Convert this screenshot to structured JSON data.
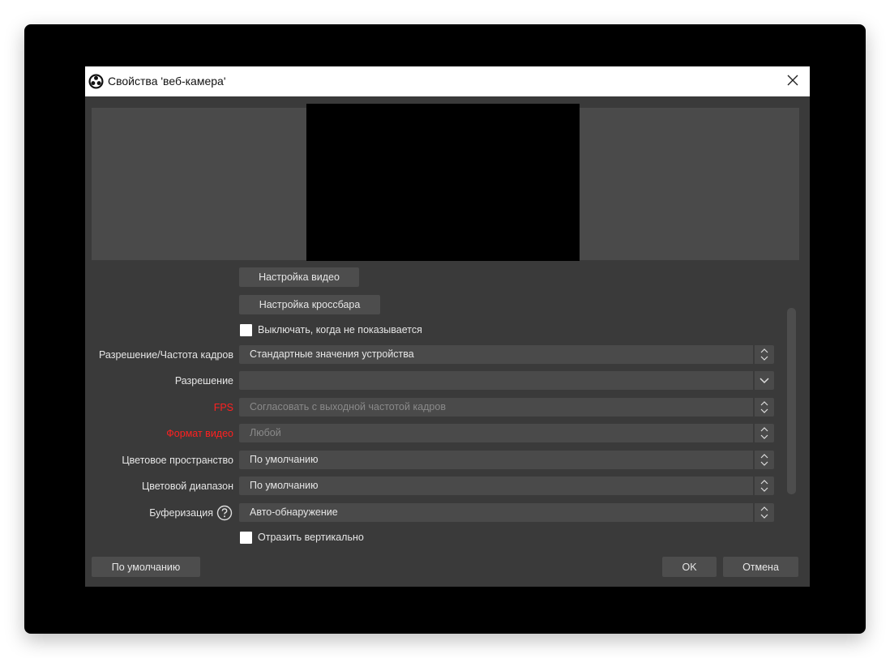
{
  "dialog": {
    "title": "Свойства 'веб-камера'",
    "icons": {
      "app": "obs-logo-icon",
      "close": "close-icon"
    }
  },
  "buttons": {
    "video_settings": "Настройка видео",
    "crossbar_settings": "Настройка кроссбара",
    "defaults": "По умолчанию",
    "ok": "OK",
    "cancel": "Отмена"
  },
  "checkboxes": {
    "deactivate_when_hidden": {
      "label": "Выключать, когда не показывается",
      "checked": false
    },
    "flip_vertical": {
      "label": "Отразить вертикально",
      "checked": false
    }
  },
  "fields": [
    {
      "label": "Разрешение/Частота кадров",
      "value": "Стандартные значения устройства",
      "control": "spin",
      "disabled": false,
      "label_color": "normal"
    },
    {
      "label": "Разрешение",
      "value": "",
      "control": "dropdown",
      "disabled": false,
      "label_color": "normal"
    },
    {
      "label": "FPS",
      "value": "Согласовать с выходной частотой кадров",
      "control": "spin",
      "disabled": true,
      "label_color": "#ff2020"
    },
    {
      "label": "Формат видео",
      "value": "Любой",
      "control": "spin",
      "disabled": true,
      "label_color": "#ff2020"
    },
    {
      "label": "Цветовое пространство",
      "value": "По умолчанию",
      "control": "spin",
      "disabled": false,
      "label_color": "normal"
    },
    {
      "label": "Цветовой диапазон",
      "value": "По умолчанию",
      "control": "spin",
      "disabled": false,
      "label_color": "normal"
    },
    {
      "label": "Буферизация",
      "value": "Авто-обнаружение",
      "control": "spin",
      "disabled": false,
      "label_color": "normal",
      "help_icon": "question-circle-icon"
    }
  ],
  "colors": {
    "dialog_bg": "#3a3a3a",
    "field_bg": "#4a4a4a",
    "error_label": "#ff2020",
    "preview_bg": "#4a4a4a",
    "video_bg": "#000000"
  }
}
